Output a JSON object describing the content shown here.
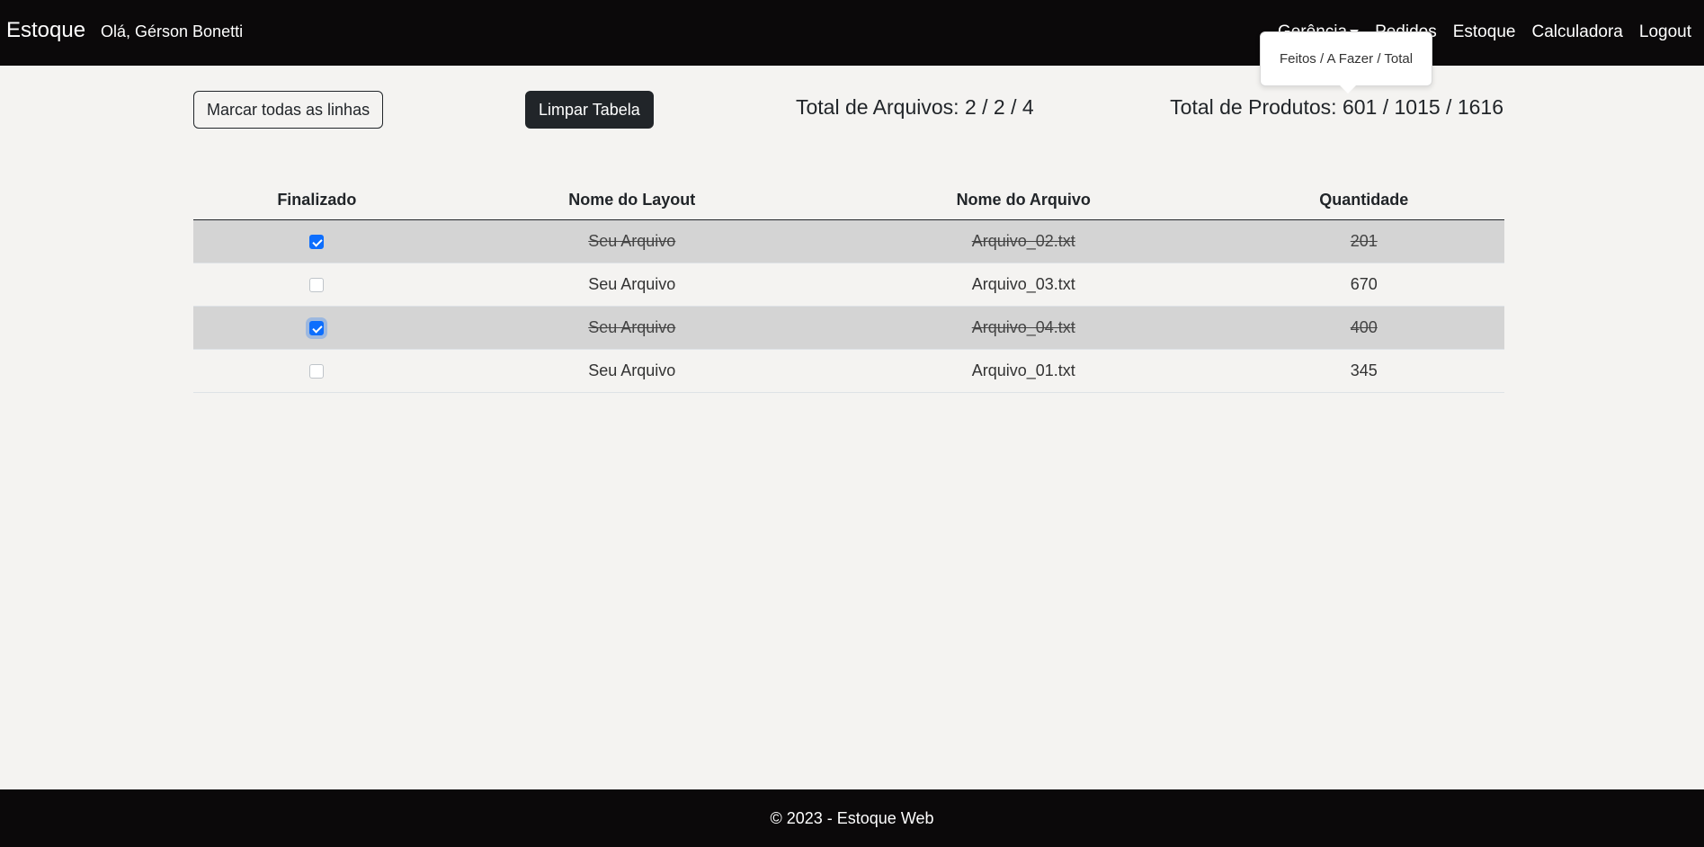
{
  "navbar": {
    "brand": "Estoque",
    "greeting": "Olá, Gérson Bonetti",
    "links": [
      {
        "label": "Gerência"
      },
      {
        "label": "Pedidos"
      },
      {
        "label": "Estoque"
      },
      {
        "label": "Calculadora"
      },
      {
        "label": "Logout"
      }
    ]
  },
  "tooltip": {
    "text": "Feitos / A Fazer / Total"
  },
  "toolbar": {
    "mark_all_label": "Marcar todas as linhas",
    "clear_label": "Limpar Tabela",
    "total_files": "Total de Arquivos: 2 / 2 / 4",
    "total_products": "Total de Produtos: 601 / 1015 / 1616"
  },
  "table": {
    "headers": [
      "Finalizado",
      "Nome do Layout",
      "Nome do Arquivo",
      "Quantidade"
    ],
    "rows": [
      {
        "finalizado": true,
        "layout": "Seu Arquivo",
        "arquivo": "Arquivo_02.txt",
        "quantidade": "201"
      },
      {
        "finalizado": false,
        "layout": "Seu Arquivo",
        "arquivo": "Arquivo_03.txt",
        "quantidade": "670"
      },
      {
        "finalizado": true,
        "layout": "Seu Arquivo",
        "arquivo": "Arquivo_04.txt",
        "quantidade": "400"
      },
      {
        "finalizado": false,
        "layout": "Seu Arquivo",
        "arquivo": "Arquivo_01.txt",
        "quantidade": "345"
      }
    ]
  },
  "footer": {
    "text": "© 2023 - Estoque Web"
  },
  "colors": {
    "navbar_bg": "#0b090a",
    "page_bg": "#f4f3f1",
    "done_row_bg": "#d4d4d4",
    "checkbox_checked": "#0d6efd",
    "dark_button": "#212529"
  }
}
